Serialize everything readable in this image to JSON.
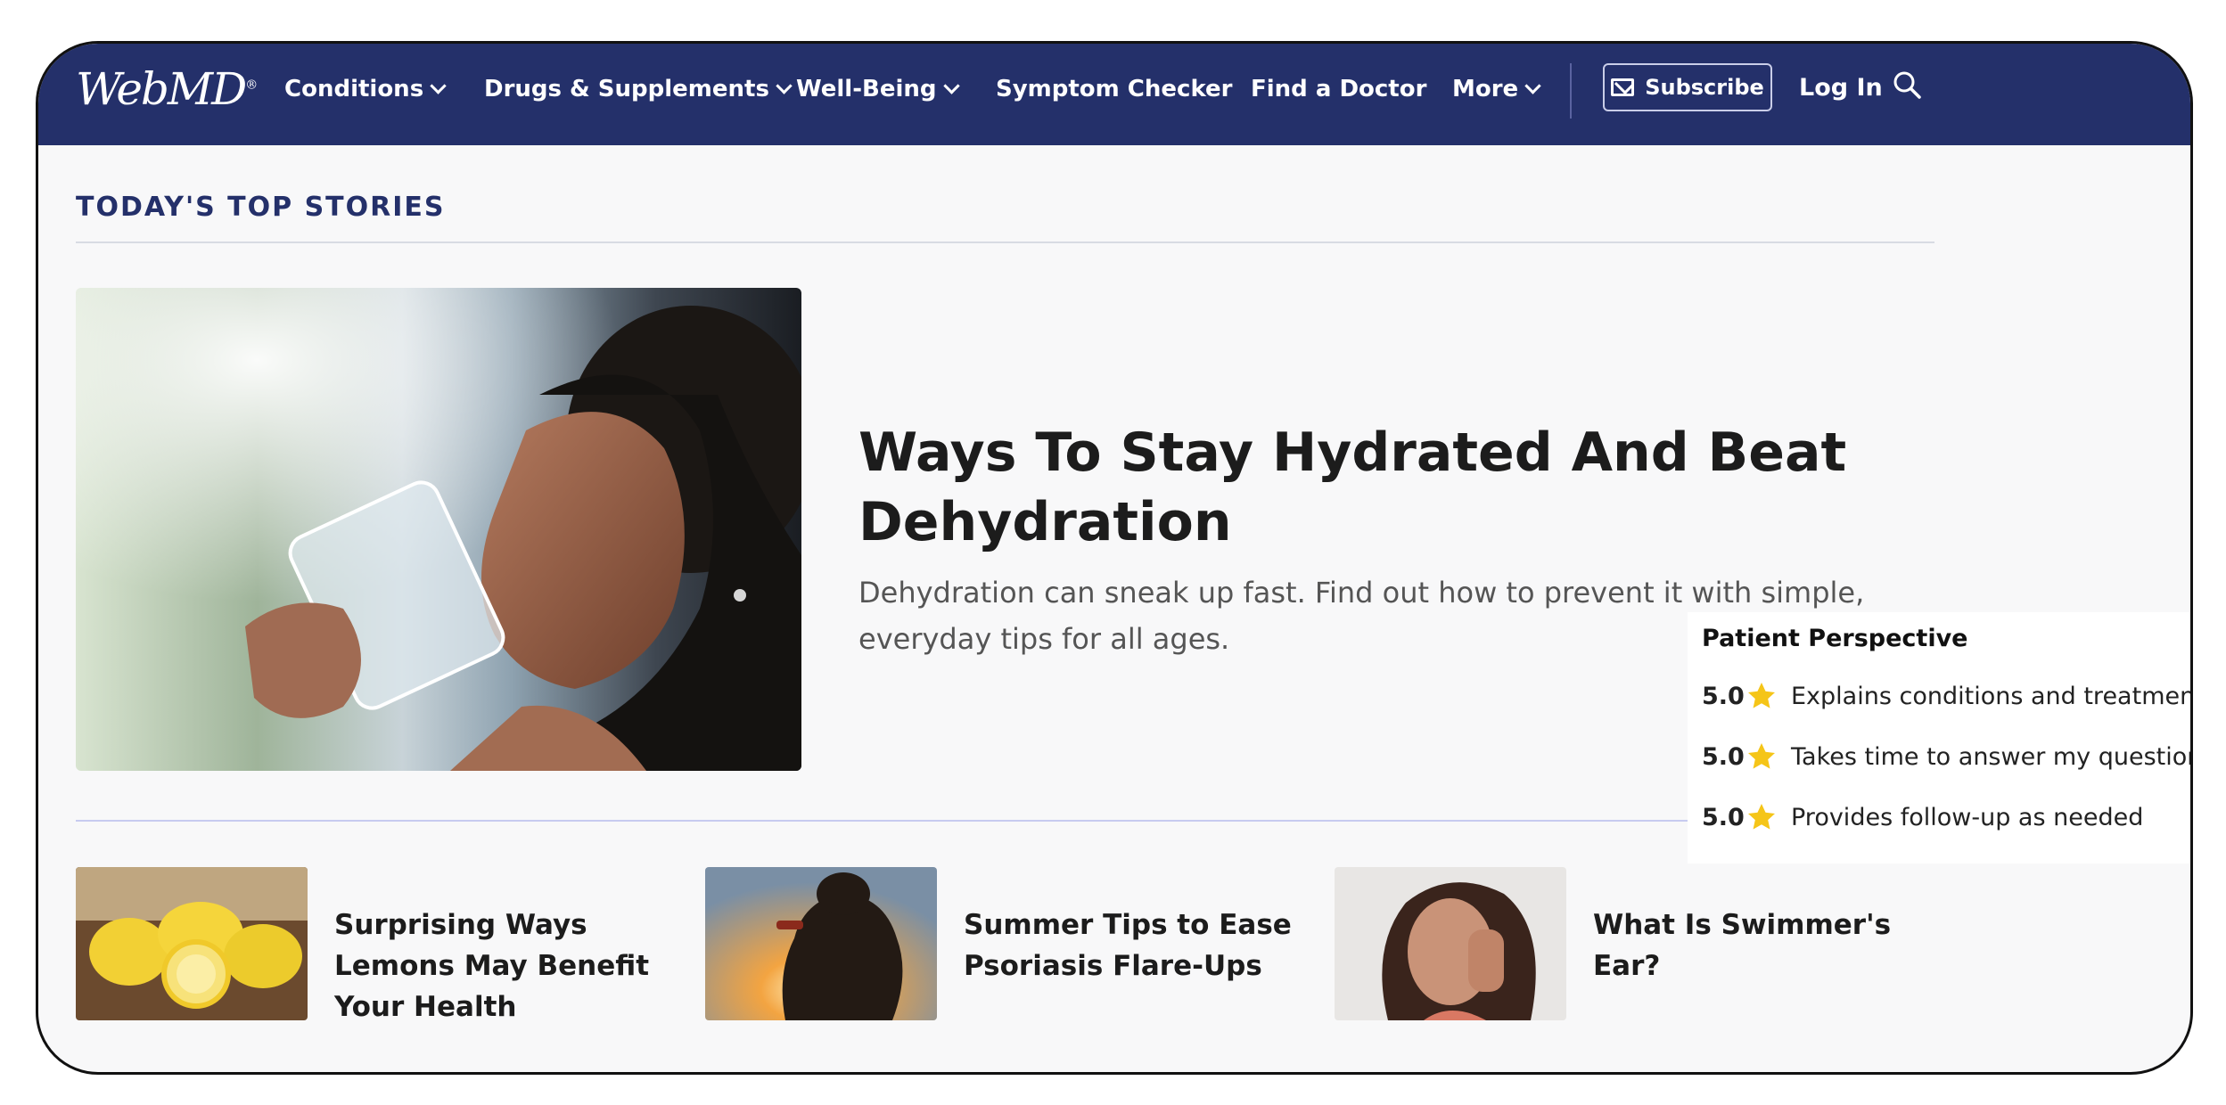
{
  "nav": {
    "logo": "WebMD",
    "items": [
      {
        "label": "Conditions",
        "dropdown": true
      },
      {
        "label": "Drugs & Supplements",
        "dropdown": true
      },
      {
        "label": "Well-Being",
        "dropdown": true
      },
      {
        "label": "Symptom Checker",
        "dropdown": false
      },
      {
        "label": "Find a Doctor",
        "dropdown": false
      },
      {
        "label": "More",
        "dropdown": true
      }
    ],
    "subscribe": "Subscribe",
    "login": "Log In",
    "colors": {
      "background": "#24306a",
      "text": "#ffffff"
    }
  },
  "section_title": "TODAY'S TOP STORIES",
  "hero": {
    "title": "Ways To Stay Hydrated And Beat Dehydration",
    "description": "Dehydration can sneak up fast. Find out how to prevent it with simple, everyday tips for all ages.",
    "image_icon": "woman-drinking-water-photo"
  },
  "stories": [
    {
      "title": "Surprising Ways Lemons May Benefit Your Health",
      "image_icon": "lemons-photo"
    },
    {
      "title": "Summer Tips to Ease Psoriasis Flare-Ups",
      "image_icon": "silhouette-sunset-photo"
    },
    {
      "title": "What Is Swimmer's Ear?",
      "image_icon": "woman-earache-photo"
    }
  ],
  "patient_perspective": {
    "title": "Patient Perspective",
    "rows": [
      {
        "score": "5.0",
        "label": "Explains conditions and treatments"
      },
      {
        "score": "5.0",
        "label": "Takes time to answer my questions"
      },
      {
        "score": "5.0",
        "label": "Provides follow-up as needed"
      }
    ],
    "star_color": "#f5c518"
  }
}
